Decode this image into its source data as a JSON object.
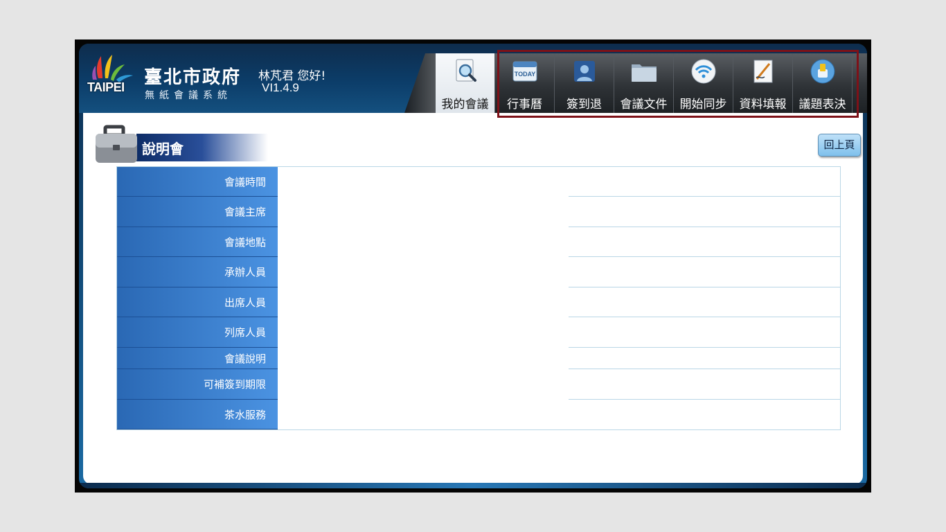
{
  "header": {
    "logo_text": "TAIPEI",
    "gov_title": "臺北市政府",
    "system_name": "無紙會議系統",
    "greeting": "林芃君 您好!",
    "version": "VI1.4.9"
  },
  "tabs": [
    {
      "label": "我的會議",
      "icon": "magnifier-document-icon",
      "active": true
    },
    {
      "label": "行事曆",
      "icon": "calendar-today-icon",
      "active": false
    },
    {
      "label": "簽到退",
      "icon": "person-sign-in-icon",
      "active": false
    },
    {
      "label": "會議文件",
      "icon": "folder-icon",
      "active": false
    },
    {
      "label": "開始同步",
      "icon": "wifi-sync-icon",
      "active": false
    },
    {
      "label": "資料填報",
      "icon": "pen-document-icon",
      "active": false
    },
    {
      "label": "議題表決",
      "icon": "vote-icon",
      "active": false
    }
  ],
  "page": {
    "title": "說明會",
    "back_label": "回上頁"
  },
  "details": {
    "rows": [
      {
        "label": "會議時間",
        "value": ""
      },
      {
        "label": "會議主席",
        "value": ""
      },
      {
        "label": "會議地點",
        "value": ""
      },
      {
        "label": "承辦人員",
        "value": ""
      },
      {
        "label": "出席人員",
        "value": ""
      },
      {
        "label": "列席人員",
        "value": ""
      },
      {
        "label": "會議說明",
        "value": ""
      },
      {
        "label": "可補簽到期限",
        "value": ""
      },
      {
        "label": "茶水服務",
        "value": ""
      }
    ]
  },
  "colors": {
    "highlight_border": "#7d1118",
    "label_blue": "#3f84d4",
    "header_navy": "#0c3d69"
  }
}
